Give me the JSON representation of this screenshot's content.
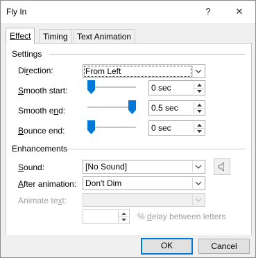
{
  "dialog": {
    "title": "Fly In",
    "help_glyph": "?",
    "close_glyph": "✕"
  },
  "tabs": [
    {
      "label": "Effect",
      "active": true
    },
    {
      "label": "Timing",
      "active": false
    },
    {
      "label": "Text Animation",
      "active": false
    }
  ],
  "settings": {
    "group_label": "Settings",
    "direction": {
      "label_pre": "Di",
      "label_accel": "r",
      "label_post": "ection:",
      "value": "From Left"
    },
    "smooth_start": {
      "label_pre": "",
      "label_accel": "S",
      "label_post": "mooth start:",
      "value": "0 sec",
      "slider_level": 0
    },
    "smooth_end": {
      "label_pre": "Smooth e",
      "label_accel": "n",
      "label_post": "d:",
      "value": "0.5 sec",
      "slider_level": 1
    },
    "bounce_end": {
      "label_pre": "",
      "label_accel": "B",
      "label_post": "ounce end:",
      "value": "0 sec",
      "slider_level": 0
    }
  },
  "enhancements": {
    "group_label": "Enhancements",
    "sound": {
      "label_pre": "",
      "label_accel": "S",
      "label_post": "ound:",
      "value": "[No Sound]",
      "icon": "speaker-icon"
    },
    "after_animation": {
      "label_pre": "",
      "label_accel": "A",
      "label_post": "fter animation:",
      "value": "Don't Dim"
    },
    "animate_text": {
      "label": "Animate te",
      "label_accel": "x",
      "label_post": "t:",
      "value": "",
      "enabled": false
    },
    "delay": {
      "value": "",
      "label_pre": "% ",
      "label_accel": "d",
      "label_post": "elay between letters",
      "enabled": false
    }
  },
  "footer": {
    "ok_label": "OK",
    "cancel_label": "Cancel"
  },
  "colors": {
    "accent": "#0078d7",
    "panel_bg": "#f0f0f0",
    "disabled_text": "#a0a0a0"
  }
}
